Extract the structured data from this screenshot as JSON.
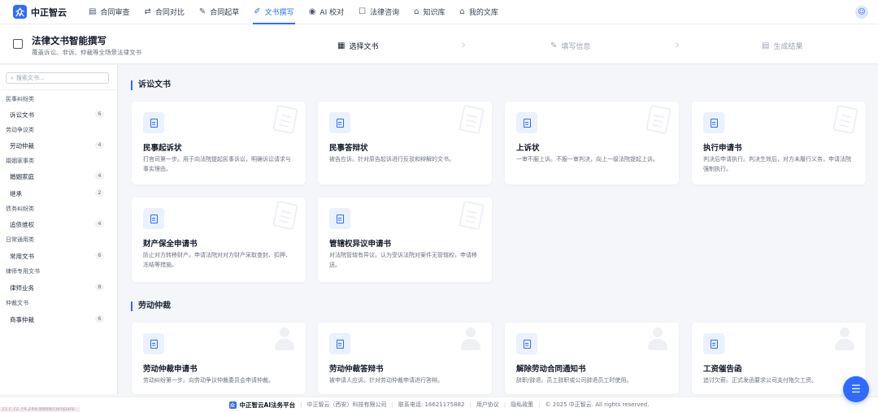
{
  "brand": {
    "logo_glyph": "众",
    "name": "中正智云"
  },
  "nav": [
    {
      "label": "合同审查",
      "icon": "document-icon",
      "glyph": "▤"
    },
    {
      "label": "合同对比",
      "icon": "swap-icon",
      "glyph": "⇄"
    },
    {
      "label": "合同起草",
      "icon": "edit-icon",
      "glyph": "✎"
    },
    {
      "label": "文书撰写",
      "icon": "pen-icon",
      "glyph": "✐",
      "active": true
    },
    {
      "label": "AI 校对",
      "icon": "check-circle-icon",
      "glyph": "◉"
    },
    {
      "label": "法律咨询",
      "icon": "chat-icon",
      "glyph": "☐"
    },
    {
      "label": "知识库",
      "icon": "library-icon",
      "glyph": "⌂"
    },
    {
      "label": "我的文库",
      "icon": "folder-icon",
      "glyph": "⌂"
    }
  ],
  "user_avatar_glyph": "☺",
  "header": {
    "title": "法律文书智能撰写",
    "desc": "覆盖诉讼、非诉、仲裁等全场景法律文书",
    "steps": [
      {
        "label": "选择文书",
        "glyph": "▦"
      },
      {
        "label": "填写信息",
        "glyph": "✎"
      },
      {
        "label": "生成结果",
        "glyph": "▤"
      }
    ]
  },
  "sidebar": {
    "search_placeholder": "搜索文书...",
    "search_glyph": "⌕",
    "groups": [
      {
        "category": "民事纠纷类",
        "items": [
          {
            "label": "诉讼文书",
            "count": "6"
          }
        ]
      },
      {
        "category": "劳动争议类",
        "items": [
          {
            "label": "劳动仲裁",
            "count": "4"
          }
        ]
      },
      {
        "category": "婚姻家事类",
        "items": [
          {
            "label": "婚姻家庭",
            "count": "4"
          },
          {
            "label": "继承",
            "count": "2"
          }
        ]
      },
      {
        "category": "债务纠纷类",
        "items": [
          {
            "label": "追债维权",
            "count": "4"
          }
        ]
      },
      {
        "category": "日常通用类",
        "items": [
          {
            "label": "常用文书",
            "count": "6"
          }
        ]
      },
      {
        "category": "律师专用文书",
        "items": [
          {
            "label": "律师业务",
            "count": "8"
          }
        ]
      },
      {
        "category": "仲裁文书",
        "items": [
          {
            "label": "商事仲裁",
            "count": "6"
          }
        ]
      }
    ]
  },
  "sections": [
    {
      "title": "诉讼文书",
      "cards": [
        {
          "title": "民事起诉状",
          "desc": "打官司第一步。用于向法院提起民事诉讼，明确诉讼请求与事实理由。"
        },
        {
          "title": "民事答辩状",
          "desc": "被告应诉。针对原告起诉进行反驳和辩解的文书。"
        },
        {
          "title": "上诉状",
          "desc": "一审不服上诉。不服一审判决，向上一级法院提起上诉。"
        },
        {
          "title": "执行申请书",
          "desc": "判决后申请执行。判决生效后，对方未履行义务，申请法院强制执行。"
        },
        {
          "title": "财产保全申请书",
          "desc": "防止对方转移财产。申请法院对对方财产采取查封、扣押、冻结等措施。"
        },
        {
          "title": "管辖权异议申请书",
          "desc": "对法院管辖有异议。认为受诉法院对案件无管辖权，申请移送。"
        }
      ]
    },
    {
      "title": "劳动仲裁",
      "cards": [
        {
          "title": "劳动仲裁申请书",
          "desc": "劳动纠纷第一步。向劳动争议仲裁委员会申请仲裁。"
        },
        {
          "title": "劳动仲裁答辩书",
          "desc": "被申请人应诉。针对劳动仲裁申请进行答辩。"
        },
        {
          "title": "解除劳动合同通知书",
          "desc": "辞职/辞退。员工辞职或公司辞退员工时使用。"
        },
        {
          "title": "工资催告函",
          "desc": "追讨欠薪。正式发函要求公司支付拖欠工资。"
        }
      ]
    }
  ],
  "footer": {
    "brand_glyph": "众",
    "brand": "中正智云AI法务平台",
    "company": "中正智云（西安）科技有限公司",
    "phone": "联系电话: 16621175882",
    "terms": "用户协议",
    "privacy": "隐私政策",
    "copyright": "© 2025 中正智云. All rights reserved."
  },
  "ip_tag": "117.72.74.246:8888/compare",
  "chat_glyph": "☰",
  "colors": {
    "accent": "#2f6bff",
    "page_bg": "#f4f6fa"
  }
}
